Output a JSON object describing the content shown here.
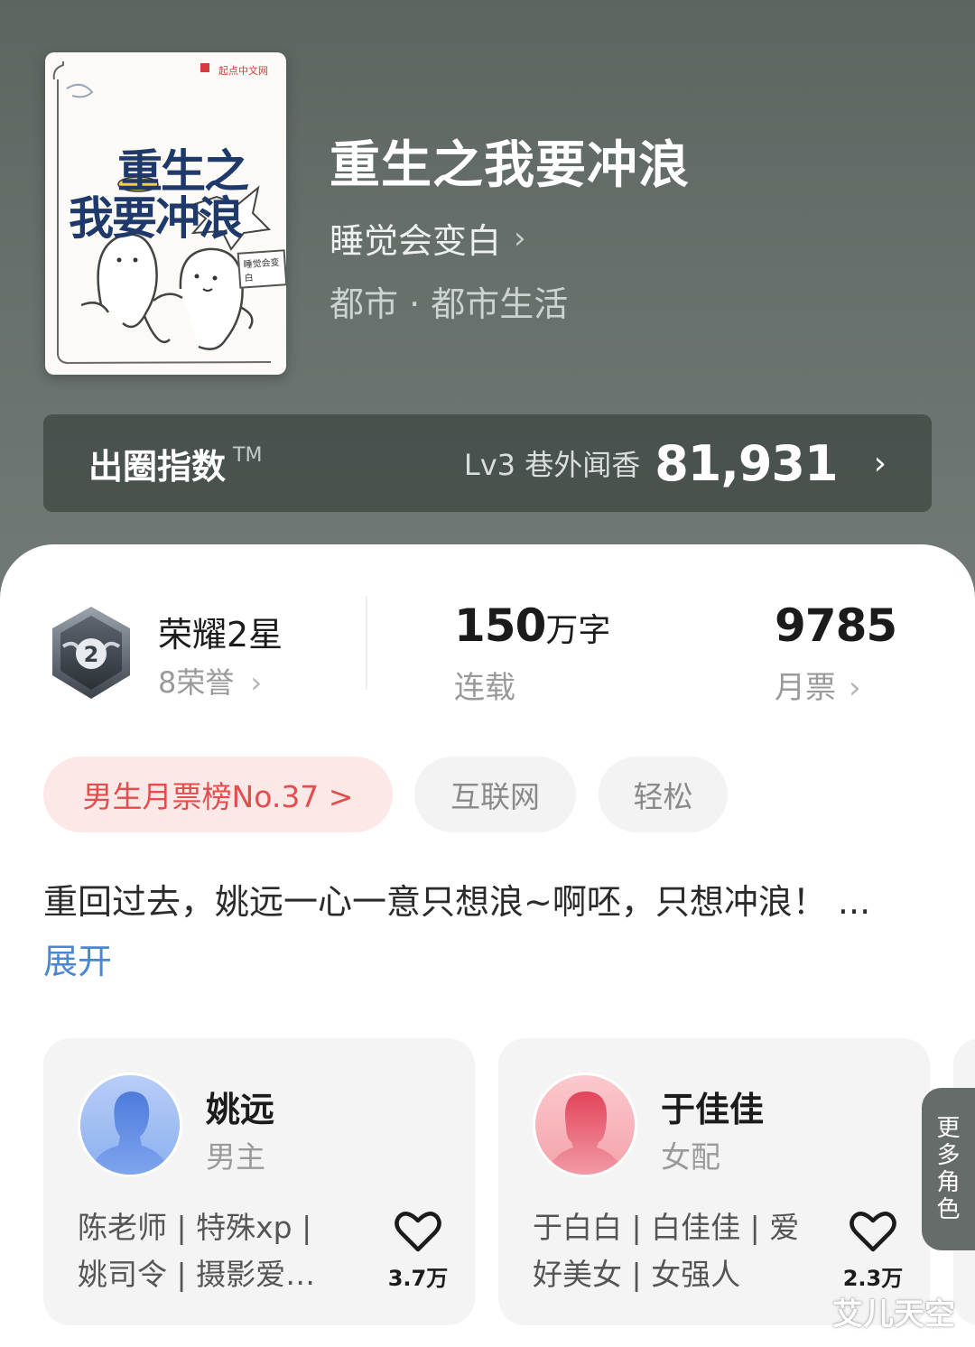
{
  "cover": {
    "publisher": "起点中文网",
    "title_line1": "重生之",
    "title_line2": "我要冲浪",
    "author_stamp": "睡觉会变白"
  },
  "book": {
    "title": "重生之我要冲浪",
    "author": "睡觉会变白",
    "genre": "都市 · 都市生活"
  },
  "index_bar": {
    "label": "出圈指数",
    "tm": "TM",
    "level": "Lv3 巷外闻香",
    "score": "81,931"
  },
  "stats": {
    "rank_name": "荣耀2星",
    "rank_sub": "8荣誉",
    "badge_number": "2",
    "word_count": "150",
    "word_unit": "万字",
    "status": "连载",
    "monthly_votes": "9785",
    "monthly_votes_label": "月票"
  },
  "tags": {
    "rank_tag": "男生月票榜No.37 >",
    "tag1": "互联网",
    "tag2": "轻松"
  },
  "synopsis": {
    "text": "重回过去，姚远一心一意只想浪~啊呸，只想冲浪！ ...",
    "expand": "展开"
  },
  "characters": [
    {
      "name": "姚远",
      "role": "男主",
      "tags_line1": "陈老师 | 特殊xp |",
      "tags_line2": "姚司令 | 摄影爱…",
      "likes": "3.7万",
      "avatar_color": "#8ab0ef"
    },
    {
      "name": "于佳佳",
      "role": "女配",
      "tags_line1": "于白白 | 白佳佳 | 爱",
      "tags_line2": "好美女 | 女强人",
      "likes": "2.3万",
      "avatar_color": "#f4a2aa"
    }
  ],
  "more_roles": {
    "c1": "更",
    "c2": "多",
    "c3": "角",
    "c4": "色"
  },
  "watermark": "艾儿天空",
  "colors": {
    "hero_bg": "#67706c",
    "rank_tag_text": "#e24d4d",
    "link": "#4a86d1"
  }
}
